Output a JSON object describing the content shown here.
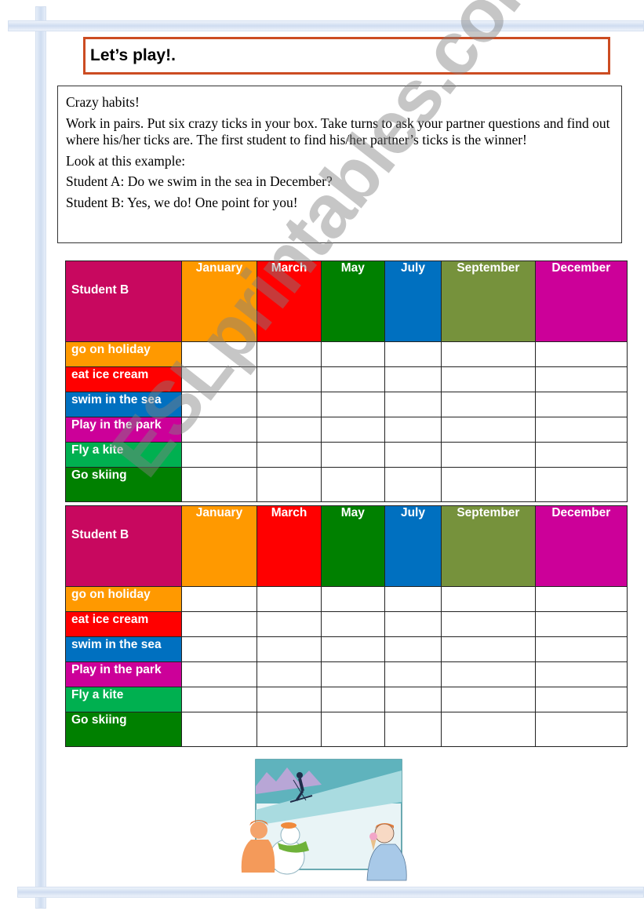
{
  "title": "Let’s play!.",
  "instructions": {
    "heading": "Crazy habits!",
    "body": "Work in pairs. Put six crazy ticks in your box. Take turns to ask your partner questions and find out where his/her ticks are. The first student to find his/her partner’s ticks is the winner!",
    "example_intro": "Look at this example:",
    "student_a": "Student A: Do we swim in the sea in December?",
    "student_b": "Student B: Yes, we do! One point for you!"
  },
  "tables": [
    {
      "corner_label": "Student B",
      "months": [
        "January",
        "March",
        "May",
        "July",
        "September",
        "December"
      ],
      "activities": [
        "go on holiday",
        "eat ice cream",
        "swim in the sea",
        "Play in the park",
        "Fly a kite",
        "Go skiing"
      ]
    },
    {
      "corner_label": "Student B",
      "months": [
        "January",
        "March",
        "May",
        "July",
        "September",
        "December"
      ],
      "activities": [
        "go on holiday",
        "eat ice cream",
        "swim in the sea",
        "Play in the park",
        "Fly a kite",
        "Go skiing"
      ]
    }
  ],
  "colors": {
    "corner": "#c8085f",
    "months": [
      "#ff9900",
      "#ff0000",
      "#008000",
      "#0070c0",
      "#76923c",
      "#cc0099"
    ],
    "activities": [
      "#ff9900",
      "#ff0000",
      "#0070c0",
      "#cc0099",
      "#00b050",
      "#008000"
    ],
    "title_border": "#cc4c22"
  },
  "watermark": "ESLprintables.com",
  "illustration": "winter-scene-skier-snowman-boy-eating-ice-cream"
}
